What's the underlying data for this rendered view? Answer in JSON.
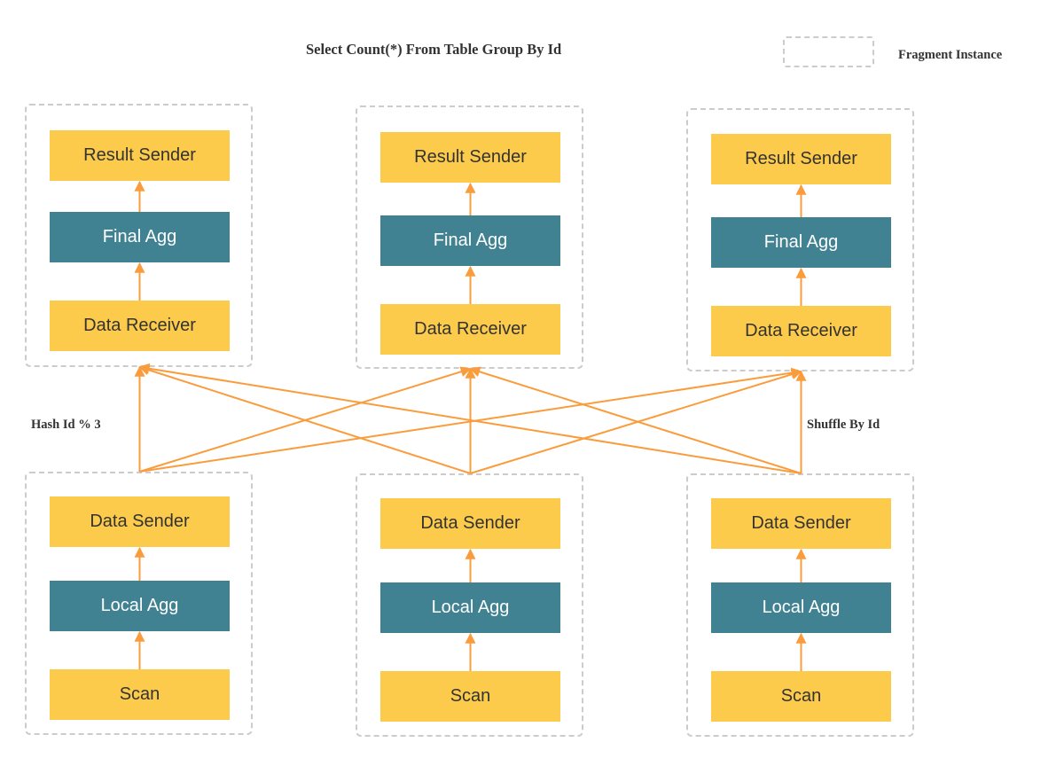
{
  "title": "Select Count(*) From Table Group By Id",
  "legend": {
    "label": "Fragment Instance",
    "icon": "dashed-box"
  },
  "labels": {
    "left": "Hash Id % 3",
    "right": "Shuffle By Id"
  },
  "colors": {
    "operator_yellow": "#fccb4b",
    "operator_teal": "#418292",
    "edge": "#fb9c3c",
    "fragment_border": "#cccccc",
    "text_dark": "#333333"
  },
  "upper_fragments": [
    {
      "nodes": [
        "Result Sender",
        "Final Agg",
        "Data Receiver"
      ]
    },
    {
      "nodes": [
        "Result Sender",
        "Final Agg",
        "Data Receiver"
      ]
    },
    {
      "nodes": [
        "Result Sender",
        "Final Agg",
        "Data Receiver"
      ]
    }
  ],
  "lower_fragments": [
    {
      "nodes": [
        "Data Sender",
        "Local Agg",
        "Scan"
      ]
    },
    {
      "nodes": [
        "Data Sender",
        "Local Agg",
        "Scan"
      ]
    },
    {
      "nodes": [
        "Data Sender",
        "Local Agg",
        "Scan"
      ]
    }
  ],
  "shuffle_edges": [
    {
      "from": "lower-0",
      "to": "upper-0"
    },
    {
      "from": "lower-0",
      "to": "upper-1"
    },
    {
      "from": "lower-0",
      "to": "upper-2"
    },
    {
      "from": "lower-1",
      "to": "upper-0"
    },
    {
      "from": "lower-1",
      "to": "upper-1"
    },
    {
      "from": "lower-1",
      "to": "upper-2"
    },
    {
      "from": "lower-2",
      "to": "upper-0"
    },
    {
      "from": "lower-2",
      "to": "upper-1"
    },
    {
      "from": "lower-2",
      "to": "upper-2"
    }
  ]
}
